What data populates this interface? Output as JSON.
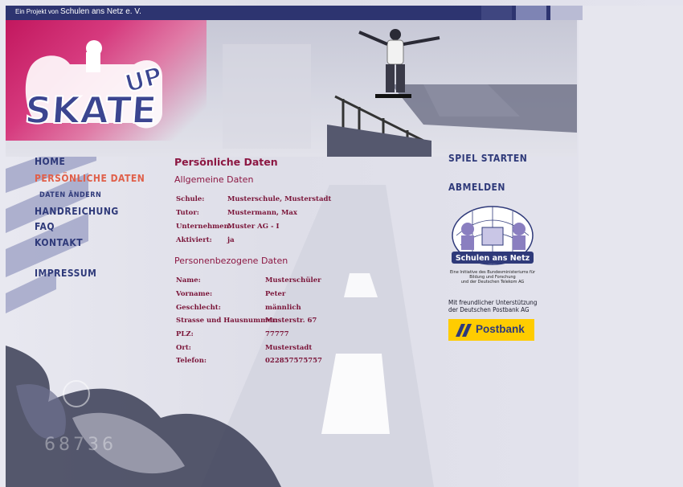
{
  "topbar": {
    "prefix": "Ein Projekt von",
    "org": "Schulen ans Netz e. V."
  },
  "logo": {
    "text_skate": "SKATE",
    "text_up": "UP"
  },
  "nav": {
    "home": "HOME",
    "persoenliche_daten": "PERSÖNLICHE DATEN",
    "daten_aendern": "DATEN ÄNDERN",
    "handreichung": "HANDREICHUNG",
    "faq": "FAQ",
    "kontakt": "KONTAKT",
    "impressum": "IMPRESSUM"
  },
  "main": {
    "title": "Persönliche Daten",
    "general_heading": "Allgemeine Daten",
    "general": [
      {
        "label": "Schule:",
        "value": "Musterschule, Musterstadt"
      },
      {
        "label": "Tutor:",
        "value": "Mustermann, Max"
      },
      {
        "label": "Unternehmen:",
        "value": "Muster AG - I"
      },
      {
        "label": "Aktiviert:",
        "value": "ja"
      }
    ],
    "personal_heading": "Personenbezogene Daten",
    "personal": [
      {
        "label": "Name:",
        "value": "Musterschüler"
      },
      {
        "label": "Vorname:",
        "value": "Peter"
      },
      {
        "label": "Geschlecht:",
        "value": "männlich"
      },
      {
        "label": "Strasse und Hausnummer:",
        "value": "Musterstr. 67"
      },
      {
        "label": "PLZ:",
        "value": "77777"
      },
      {
        "label": "Ort:",
        "value": "Musterstadt"
      },
      {
        "label": "Telefon:",
        "value": "022857575757"
      }
    ]
  },
  "right": {
    "spiel_starten": "SPIEL STARTEN",
    "abmelden": "ABMELDEN",
    "san_logo_text": "Schulen ans Netz",
    "san_caption": [
      "Eine Initiative des Bundesministeriums für",
      "Bildung und Forschung",
      "und der Deutschen Telekom AG"
    ],
    "support_text": [
      "Mit freundlicher Unterstützung",
      "der Deutschen Postbank AG"
    ],
    "postbank": "Postbank"
  },
  "decor": {
    "number": "68736"
  },
  "colors": {
    "navy": "#2d3470",
    "magenta": "#c2175e",
    "content_red": "#8c1742",
    "nav_active": "#e0604a",
    "postbank_yellow": "#ffcc00"
  }
}
